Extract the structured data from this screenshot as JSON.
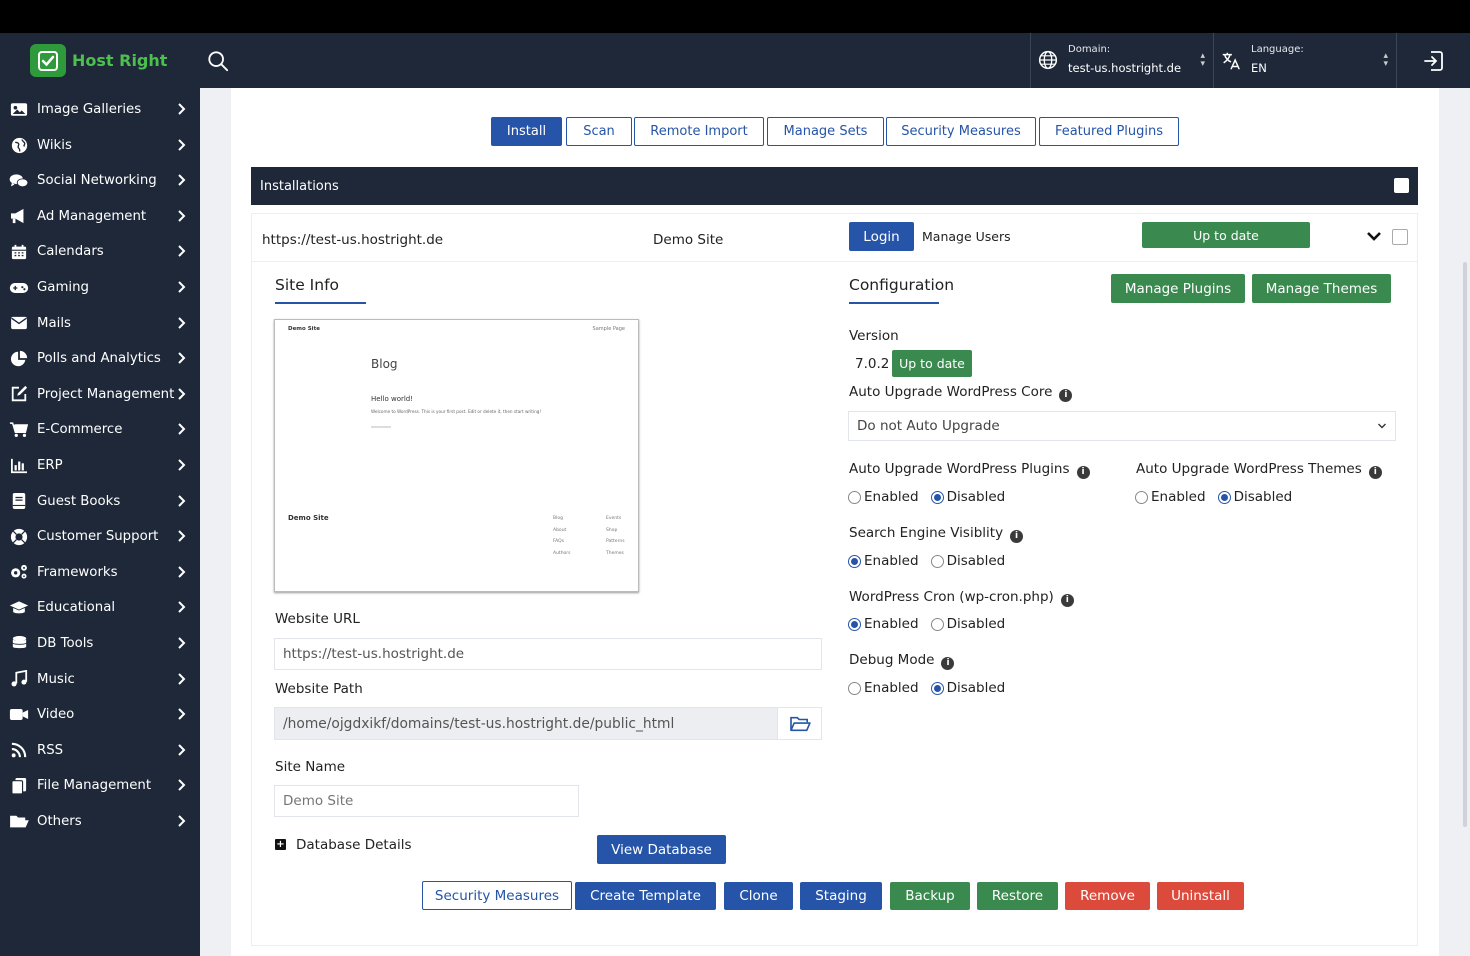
{
  "header": {
    "brand": "Host Right",
    "domain_label": "Domain:",
    "domain_value": "test-us.hostright.de",
    "language_label": "Language:",
    "language_value": "EN"
  },
  "sidebar": {
    "items": [
      {
        "label": "Image Galleries",
        "icon": "image-icon"
      },
      {
        "label": "Wikis",
        "icon": "globe-icon"
      },
      {
        "label": "Social Networking",
        "icon": "comments-icon"
      },
      {
        "label": "Ad Management",
        "icon": "bullhorn-icon"
      },
      {
        "label": "Calendars",
        "icon": "calendar-icon"
      },
      {
        "label": "Gaming",
        "icon": "gamepad-icon"
      },
      {
        "label": "Mails",
        "icon": "envelope-icon"
      },
      {
        "label": "Polls and Analytics",
        "icon": "chart-pie-icon"
      },
      {
        "label": "Project Management",
        "icon": "edit-icon"
      },
      {
        "label": "E-Commerce",
        "icon": "cart-icon"
      },
      {
        "label": "ERP",
        "icon": "bar-chart-icon"
      },
      {
        "label": "Guest Books",
        "icon": "book-icon"
      },
      {
        "label": "Customer Support",
        "icon": "lifebuoy-icon"
      },
      {
        "label": "Frameworks",
        "icon": "cogs-icon"
      },
      {
        "label": "Educational",
        "icon": "graduation-cap-icon"
      },
      {
        "label": "DB Tools",
        "icon": "database-icon"
      },
      {
        "label": "Music",
        "icon": "music-icon"
      },
      {
        "label": "Video",
        "icon": "video-icon"
      },
      {
        "label": "RSS",
        "icon": "rss-icon"
      },
      {
        "label": "File Management",
        "icon": "files-icon"
      },
      {
        "label": "Others",
        "icon": "folder-open-icon"
      }
    ]
  },
  "tabs": [
    "Install",
    "Scan",
    "Remote Import",
    "Manage Sets",
    "Security Measures",
    "Featured Plugins"
  ],
  "installations": {
    "title": "Installations",
    "url": "https://test-us.hostright.de",
    "site_name": "Demo Site",
    "login_label": "Login",
    "manage_users_label": "Manage Users",
    "status_label": "Up to date"
  },
  "site_info": {
    "title": "Site Info",
    "preview": {
      "site_title": "Demo Site",
      "sample_page": "Sample Page",
      "blog": "Blog",
      "post_title": "Hello world!",
      "post_excerpt": "Welcome to WordPress. This is your first post. Edit or delete it, then start writing!",
      "footer_title": "Demo Site",
      "footer_col1": [
        "Blog",
        "About",
        "FAQs",
        "Authors"
      ],
      "footer_col2": [
        "Events",
        "Shop",
        "Patterns",
        "Themes"
      ]
    },
    "website_url_label": "Website URL",
    "website_url": "https://test-us.hostright.de",
    "website_path_label": "Website Path",
    "website_path": "/home/ojgdxikf/domains/test-us.hostright.de/public_html",
    "site_name_label": "Site Name",
    "site_name_placeholder": "Demo Site",
    "database_details_label": "Database Details",
    "view_database_label": "View Database"
  },
  "configuration": {
    "title": "Configuration",
    "manage_plugins_label": "Manage Plugins",
    "manage_themes_label": "Manage Themes",
    "version_label": "Version",
    "version_value": "7.0.2",
    "version_status": "Up to date",
    "auto_upgrade_core_label": "Auto Upgrade WordPress Core",
    "auto_upgrade_core_value": "Do not Auto Upgrade",
    "auto_upgrade_plugins_label": "Auto Upgrade WordPress Plugins",
    "auto_upgrade_themes_label": "Auto Upgrade WordPress Themes",
    "search_engine_label": "Search Engine Visiblity",
    "cron_label": "WordPress Cron (wp-cron.php)",
    "debug_label": "Debug Mode",
    "enabled_label": "Enabled",
    "disabled_label": "Disabled"
  },
  "actions": [
    "Security Measures",
    "Create Template",
    "Clone",
    "Staging",
    "Backup",
    "Restore",
    "Remove",
    "Uninstall"
  ],
  "colors": {
    "dark": "#1e2838",
    "primary": "#2554a8",
    "success": "#3a8a4f",
    "danger": "#dc4a3c"
  }
}
